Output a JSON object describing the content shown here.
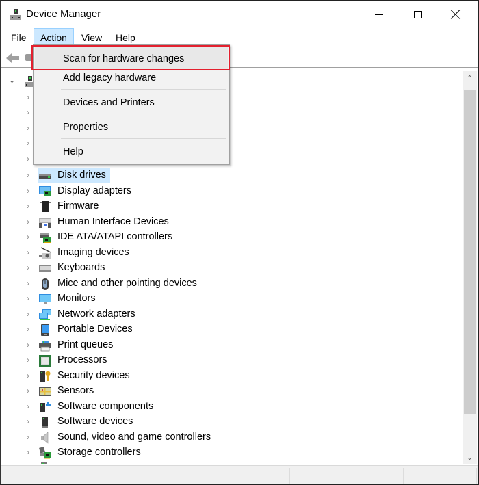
{
  "window": {
    "title": "Device Manager",
    "app_icon": "device-manager-icon",
    "controls": {
      "minimize": "minimize",
      "maximize": "maximize",
      "close": "close"
    }
  },
  "menubar": {
    "items": [
      {
        "label": "File"
      },
      {
        "label": "Action",
        "active": true
      },
      {
        "label": "View"
      },
      {
        "label": "Help"
      }
    ]
  },
  "toolbar": {
    "buttons": [
      {
        "icon": "back-arrow-icon"
      },
      {
        "icon": "forward-icon"
      }
    ]
  },
  "action_menu": {
    "items": [
      {
        "label": "Scan for hardware changes",
        "highlighted": true
      },
      {
        "label": "Add legacy hardware"
      },
      {
        "label": "Devices and Printers"
      },
      {
        "label": "Properties"
      },
      {
        "label": "Help"
      }
    ],
    "highlight_color": "#e3202e"
  },
  "tree": {
    "root_icon": "computer-icon",
    "items": [
      {
        "label": "Disk drives",
        "icon": "disk-drive-icon",
        "selected": true
      },
      {
        "label": "Display adapters",
        "icon": "display-adapter-icon"
      },
      {
        "label": "Firmware",
        "icon": "firmware-chip-icon"
      },
      {
        "label": "Human Interface Devices",
        "icon": "hid-icon"
      },
      {
        "label": "IDE ATA/ATAPI controllers",
        "icon": "ide-controller-icon"
      },
      {
        "label": "Imaging devices",
        "icon": "camera-icon"
      },
      {
        "label": "Keyboards",
        "icon": "keyboard-icon"
      },
      {
        "label": "Mice and other pointing devices",
        "icon": "mouse-icon"
      },
      {
        "label": "Monitors",
        "icon": "monitor-icon"
      },
      {
        "label": "Network adapters",
        "icon": "network-adapter-icon"
      },
      {
        "label": "Portable Devices",
        "icon": "portable-device-icon"
      },
      {
        "label": "Print queues",
        "icon": "printer-icon"
      },
      {
        "label": "Processors",
        "icon": "processor-icon"
      },
      {
        "label": "Security devices",
        "icon": "security-key-icon"
      },
      {
        "label": "Sensors",
        "icon": "sensor-icon"
      },
      {
        "label": "Software components",
        "icon": "software-component-icon"
      },
      {
        "label": "Software devices",
        "icon": "software-device-icon"
      },
      {
        "label": "Sound, video and game controllers",
        "icon": "speaker-icon"
      },
      {
        "label": "Storage controllers",
        "icon": "storage-controller-icon"
      }
    ],
    "selection_color": "#cce8ff"
  },
  "glyphs": {
    "expand": "›",
    "collapse": "⌄",
    "scroll_up": "︿",
    "scroll_down": "﹀"
  }
}
